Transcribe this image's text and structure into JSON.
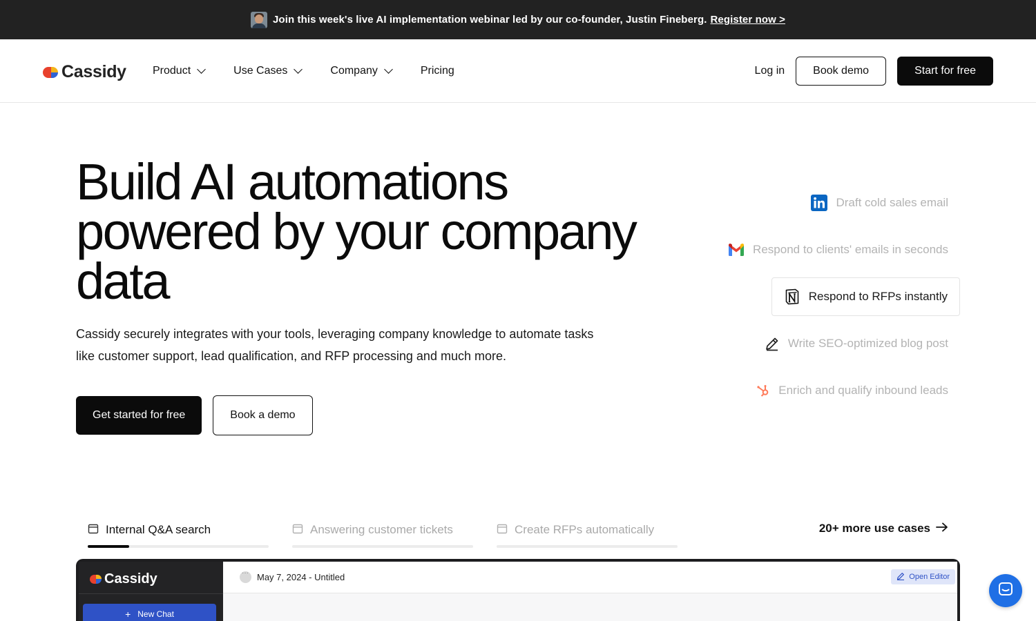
{
  "banner": {
    "text": "Join this week's live AI implementation webinar led by our co-founder, Justin Fineberg.",
    "link": "Register now >"
  },
  "nav": {
    "logo": "Cassidy",
    "items": [
      {
        "label": "Product",
        "dropdown": true
      },
      {
        "label": "Use Cases",
        "dropdown": true
      },
      {
        "label": "Company",
        "dropdown": true
      },
      {
        "label": "Pricing",
        "dropdown": false
      }
    ],
    "login": "Log in",
    "book_demo": "Book demo",
    "start_free": "Start for free"
  },
  "hero": {
    "title": "Build AI automations powered by your company data",
    "subtitle": "Cassidy securely integrates with your tools, leveraging company knowledge to automate tasks like customer support, lead qualification, and RFP processing and much more.",
    "primary_cta": "Get started for free",
    "secondary_cta": "Book a demo"
  },
  "use_cases": [
    {
      "label": "Draft cold sales email",
      "icon": "linkedin-icon",
      "active": false
    },
    {
      "label": "Respond to clients' emails in seconds",
      "icon": "gmail-icon",
      "active": false
    },
    {
      "label": "Respond to RFPs instantly",
      "icon": "notion-icon",
      "active": true
    },
    {
      "label": "Write SEO-optimized blog post",
      "icon": "pencil-icon",
      "active": false
    },
    {
      "label": "Enrich and qualify inbound leads",
      "icon": "hubspot-icon",
      "active": false
    }
  ],
  "tabs": [
    {
      "label": "Internal Q&A search",
      "active": true,
      "progress": 0.23
    },
    {
      "label": "Answering customer tickets",
      "active": false,
      "progress": 0
    },
    {
      "label": "Create RFPs automatically",
      "active": false,
      "progress": 0
    }
  ],
  "more_use_cases": "20+ more use cases",
  "app_preview": {
    "logo": "Cassidy",
    "new_chat": "New Chat",
    "doc_title": "May 7, 2024 - Untitled",
    "open_editor": "Open Editor"
  },
  "colors": {
    "banner_bg": "#222222",
    "primary": "#0b0b0b",
    "accent_blue": "#2f52c6",
    "chat_launcher": "#1f6fe5",
    "muted_text": "#b3b3b3"
  }
}
